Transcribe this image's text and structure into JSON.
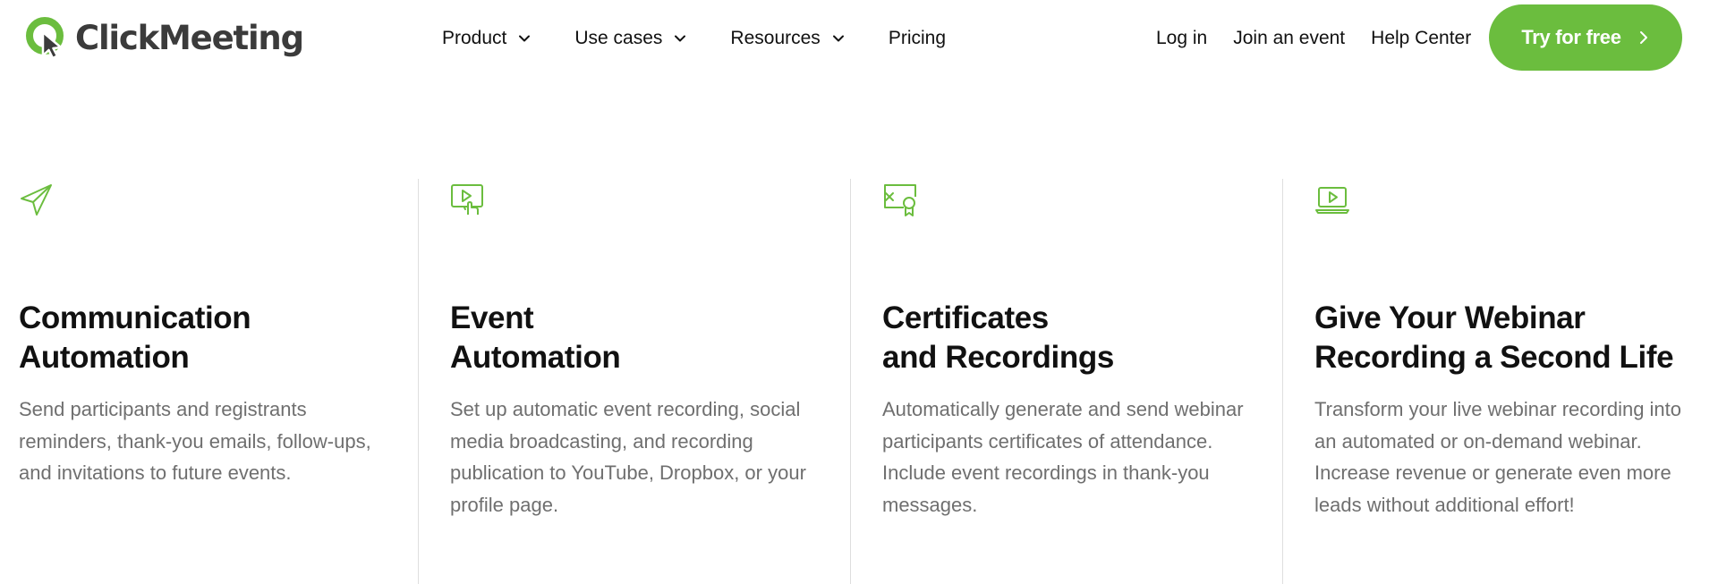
{
  "brand": {
    "name": "ClickMeeting",
    "accent": "#6bbd3e"
  },
  "nav": {
    "items": [
      {
        "label": "Product",
        "has_dropdown": true
      },
      {
        "label": "Use cases",
        "has_dropdown": true
      },
      {
        "label": "Resources",
        "has_dropdown": true
      },
      {
        "label": "Pricing",
        "has_dropdown": false
      }
    ],
    "right_links": [
      {
        "label": "Log in"
      },
      {
        "label": "Join an event"
      },
      {
        "label": "Help Center"
      }
    ],
    "cta": {
      "label": "Try for free",
      "icon": "chevron-right-icon"
    }
  },
  "features": [
    {
      "icon": "paper-plane-icon",
      "title_line1": "Communication",
      "title_line2": "Automation",
      "description": "Send participants and registrants reminders, thank-you emails, follow-ups, and invitations to future events."
    },
    {
      "icon": "screen-play-touch-icon",
      "title_line1": "Event",
      "title_line2": "Automation",
      "description": "Set up automatic event recording, social media broadcasting, and recording publication to YouTube, Dropbox, or your profile page."
    },
    {
      "icon": "certificate-icon",
      "title_line1": "Certificates",
      "title_line2": "and Recordings",
      "description": "Automatically generate and send webinar participants certificates of attendance. Include event recordings in thank-you messages."
    },
    {
      "icon": "laptop-play-icon",
      "title_line1": "Give Your Webinar",
      "title_line2": "Recording a Second Life",
      "description": "Transform your live webinar recording into an automated or on-demand webinar. Increase revenue or generate even more leads without additional effort!"
    }
  ]
}
